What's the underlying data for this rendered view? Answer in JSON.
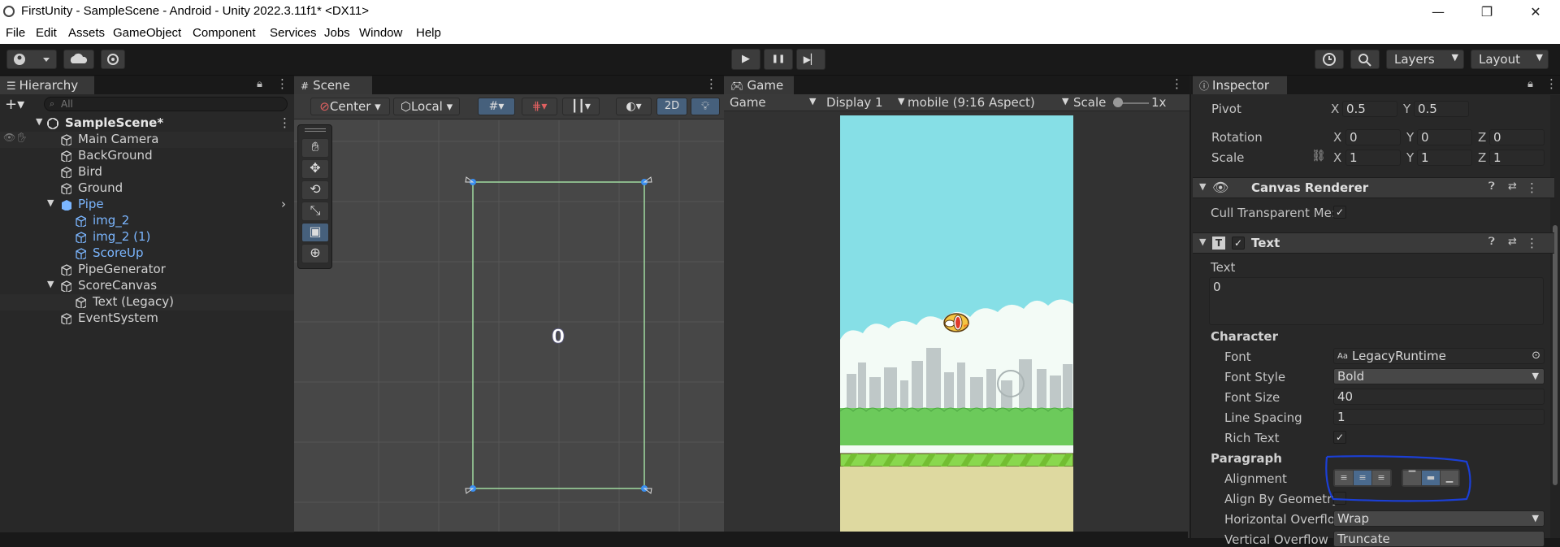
{
  "titlebar": {
    "title": "FirstUnity - SampleScene - Android - Unity 2022.3.11f1* <DX11>",
    "minimize": "—",
    "maximize": "❐",
    "close": "✕"
  },
  "menu": [
    "File",
    "Edit",
    "Assets",
    "GameObject",
    "Component",
    "Services",
    "Jobs",
    "Window",
    "Help"
  ],
  "toolbar": {
    "play": "▶",
    "pause": "❚❚",
    "step": "▶▏",
    "layers": "Layers",
    "layout": "Layout"
  },
  "hierarchy": {
    "tab": "Hierarchy",
    "search_placeholder": "All",
    "scene": "SampleScene*",
    "items": [
      {
        "label": "Main Camera",
        "indent": 1,
        "prefab": false,
        "selected": true
      },
      {
        "label": "BackGround",
        "indent": 1,
        "prefab": false
      },
      {
        "label": "Bird",
        "indent": 1,
        "prefab": false
      },
      {
        "label": "Ground",
        "indent": 1,
        "prefab": false
      },
      {
        "label": "Pipe",
        "indent": 1,
        "prefab": true,
        "expanded": true
      },
      {
        "label": "img_2",
        "indent": 2,
        "prefab": true
      },
      {
        "label": "img_2 (1)",
        "indent": 2,
        "prefab": true
      },
      {
        "label": "ScoreUp",
        "indent": 2,
        "prefab": true
      },
      {
        "label": "PipeGenerator",
        "indent": 1,
        "prefab": false
      },
      {
        "label": "ScoreCanvas",
        "indent": 1,
        "prefab": false,
        "expanded": true
      },
      {
        "label": "Text (Legacy)",
        "indent": 2,
        "prefab": false,
        "selected": true
      },
      {
        "label": "EventSystem",
        "indent": 1,
        "prefab": false
      }
    ]
  },
  "scene": {
    "tab": "Scene",
    "pivot": "Center",
    "space": "Local",
    "mode2d": "2D",
    "score_text": "0"
  },
  "game": {
    "tab": "Game",
    "dropdown": "Game",
    "display": "Display 1",
    "aspect": "mobile (9:16 Aspect)",
    "scale_label": "Scale",
    "scale_value": "1x"
  },
  "inspector": {
    "tab": "Inspector",
    "pivot_label": "Pivot",
    "pivot_x": "0.5",
    "pivot_y": "0.5",
    "rotation_label": "Rotation",
    "rot_x": "0",
    "rot_y": "0",
    "rot_z": "0",
    "scale_label": "Scale",
    "scale_x": "1",
    "scale_y": "1",
    "scale_z": "1",
    "canvas_renderer": "Canvas Renderer",
    "cull_label": "Cull Transparent Me:",
    "text_component": "Text",
    "text_label": "Text",
    "text_value": "0",
    "character": "Character",
    "font_label": "Font",
    "font_value": "LegacyRuntime",
    "font_style_label": "Font Style",
    "font_style_value": "Bold",
    "font_size_label": "Font Size",
    "font_size_value": "40",
    "line_spacing_label": "Line Spacing",
    "line_spacing_value": "1",
    "rich_text_label": "Rich Text",
    "paragraph": "Paragraph",
    "alignment_label": "Alignment",
    "align_geometry_label": "Align By Geometry",
    "horiz_overflow_label": "Horizontal Overflo",
    "horiz_overflow_value": "Wrap",
    "vert_overflow_label": "Vertical Overflow",
    "vert_overflow_value": "Truncate"
  },
  "colors": {
    "accent_blue": "#1b3fd6",
    "sky": "#86dfe6",
    "grass": "#6cca5b",
    "ground": "#ded9a0"
  }
}
